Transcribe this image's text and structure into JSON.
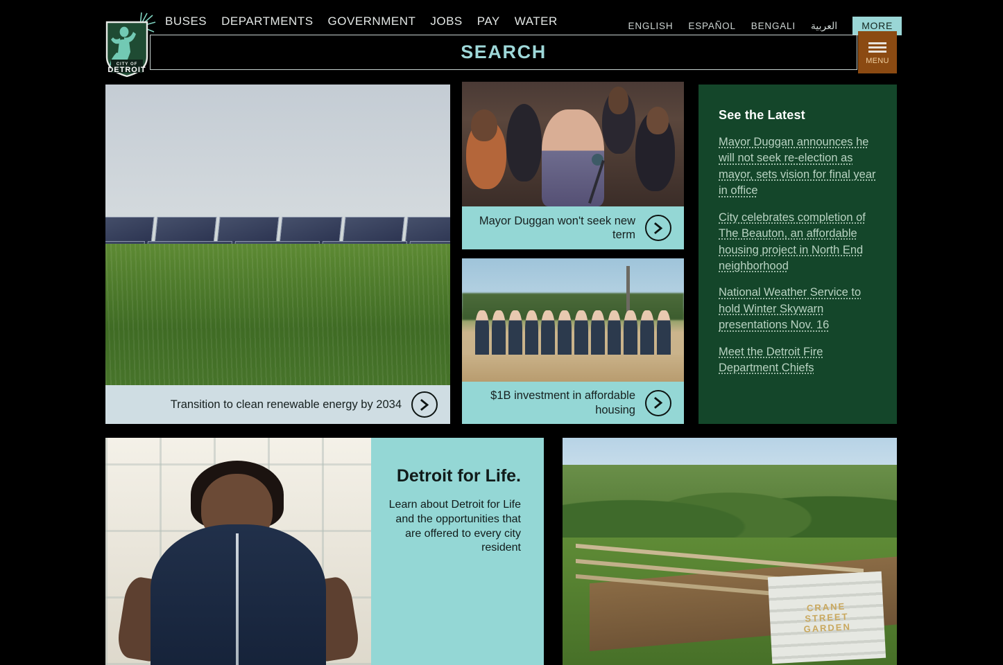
{
  "header": {
    "logo_alt": "City of Detroit",
    "logo_text_top": "CITY OF",
    "logo_text_bottom": "DETROIT",
    "nav": [
      {
        "label": "BUSES"
      },
      {
        "label": "DEPARTMENTS"
      },
      {
        "label": "GOVERNMENT"
      },
      {
        "label": "JOBS"
      },
      {
        "label": "PAY"
      },
      {
        "label": "WATER"
      }
    ],
    "languages": [
      {
        "label": "ENGLISH"
      },
      {
        "label": "ESPAÑOL"
      },
      {
        "label": "BENGALI"
      },
      {
        "label": "العربية"
      }
    ],
    "more_label": "MORE",
    "search_label": "SEARCH",
    "search_placeholder": "SEARCH",
    "menu_label": "MENU",
    "colors": {
      "background": "#000000",
      "accent_teal": "#9ad6d6",
      "menu_brown": "#8b4a12",
      "menu_label_color": "#f0cfa0"
    }
  },
  "hero": {
    "caption": "Transition to clean renewable energy by 2034",
    "image_alt": "Solar panels in a grassy field",
    "caption_bg": "#cfdde3",
    "arrow_label": "›"
  },
  "cards": [
    {
      "caption": "Mayor Duggan won't seek new term",
      "image_alt": "Mayor Duggan speaking at a podium surrounded by applauding supporters",
      "caption_bg": "#94d7d5"
    },
    {
      "caption": "$1B investment in affordable housing",
      "image_alt": "Officials with shovels at a groundbreaking ceremony",
      "caption_bg": "#94d7d5"
    }
  ],
  "latest": {
    "title": "See the Latest",
    "panel_bg": "#14462a",
    "links": [
      {
        "label": "Mayor Duggan announces he will not seek re-election as mayor, sets vision for final year in office"
      },
      {
        "label": "City celebrates completion of The Beauton, an affordable housing project in North End neighborhood"
      },
      {
        "label": "National Weather Service to hold Winter Skywarn presentations Nov. 16"
      },
      {
        "label": "Meet the Detroit Fire Department Chiefs"
      }
    ]
  },
  "detroit_for_life": {
    "title": "Detroit for Life.",
    "body": "Learn about Detroit for Life and the opportunities that are offered to every city resident",
    "image_alt": "Portrait of a woman standing with hands on hips in a bright lobby",
    "panel_bg": "#94d7d5"
  },
  "garden": {
    "image_alt": "Community garden with a wooden fence and painted sign",
    "sign_line1": "CRANE",
    "sign_line2": "STREET",
    "sign_line3": "GARDEN"
  }
}
